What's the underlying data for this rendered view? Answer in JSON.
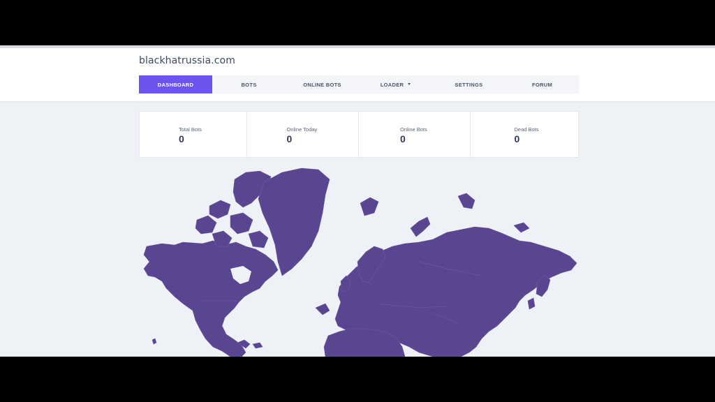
{
  "site": {
    "brand": "blackhatrussia.com"
  },
  "nav": {
    "items": [
      {
        "label": "DASHBOARD",
        "active": true
      },
      {
        "label": "BOTS"
      },
      {
        "label": "ONLINE BOTS"
      },
      {
        "label": "LOADER",
        "dropdown": true
      },
      {
        "label": "SETTINGS"
      },
      {
        "label": "FORUM"
      }
    ]
  },
  "stats": [
    {
      "label": "Total Bots",
      "value": "0"
    },
    {
      "label": "Online Today",
      "value": "0"
    },
    {
      "label": "Online Bots",
      "value": "0"
    },
    {
      "label": "Dead Bots",
      "value": "0"
    }
  ],
  "colors": {
    "accent": "#6b55ee",
    "map_fill": "#5a4590",
    "background": "#eef1f5"
  }
}
